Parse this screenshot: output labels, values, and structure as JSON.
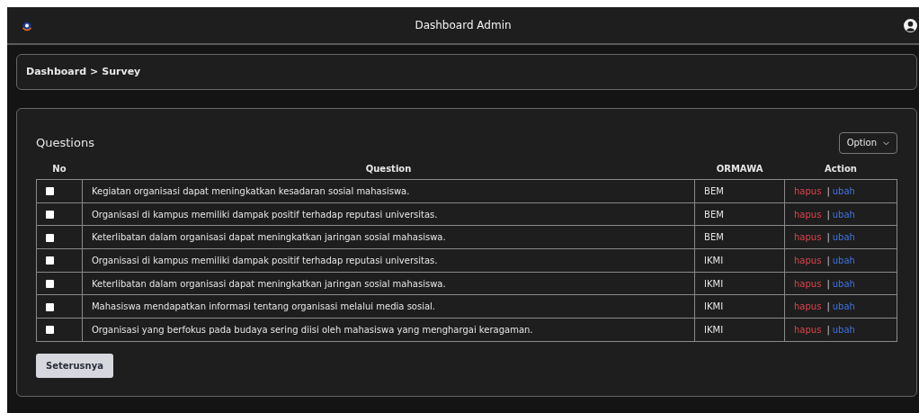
{
  "navbar": {
    "title": "Dashboard Admin"
  },
  "breadcrumb": [
    "Dashboard",
    ">",
    "Survey"
  ],
  "card": {
    "title": "Questions",
    "option_button": "Option"
  },
  "table": {
    "columns": [
      "No",
      "Question",
      "ORMAWA",
      "Action"
    ],
    "rows": [
      {
        "checked": false,
        "question": "Kegiatan organisasi dapat meningkatkan kesadaran sosial mahasiswa.",
        "ormawa": "BEM",
        "actions": [
          "hapus",
          "|",
          "ubah"
        ]
      },
      {
        "checked": false,
        "question": "Organisasi di kampus memiliki dampak positif terhadap reputasi universitas.",
        "ormawa": "BEM",
        "actions": [
          "hapus",
          "|",
          "ubah"
        ]
      },
      {
        "checked": false,
        "question": "Keterlibatan dalam organisasi dapat meningkatkan jaringan sosial mahasiswa.",
        "ormawa": "BEM",
        "actions": [
          "hapus",
          "|",
          "ubah"
        ]
      },
      {
        "checked": false,
        "question": "Organisasi di kampus memiliki dampak positif terhadap reputasi universitas.",
        "ormawa": "IKMI",
        "actions": [
          "hapus",
          "|",
          "ubah"
        ]
      },
      {
        "checked": false,
        "question": "Keterlibatan dalam organisasi dapat meningkatkan jaringan sosial mahasiswa.",
        "ormawa": "IKMI",
        "actions": [
          "hapus",
          "|",
          "ubah"
        ]
      },
      {
        "checked": false,
        "question": "Mahasiswa mendapatkan informasi tentang organisasi melalui media sosial.",
        "ormawa": "IKMI",
        "actions": [
          "hapus",
          "|",
          "ubah"
        ]
      },
      {
        "checked": false,
        "question": "Organisasi yang berfokus pada budaya sering diisi oleh mahasiswa yang menghargai keragaman.",
        "ormawa": "IKMI",
        "actions": [
          "hapus",
          "|",
          "ubah"
        ]
      }
    ]
  },
  "next_button": "Seterusnya"
}
